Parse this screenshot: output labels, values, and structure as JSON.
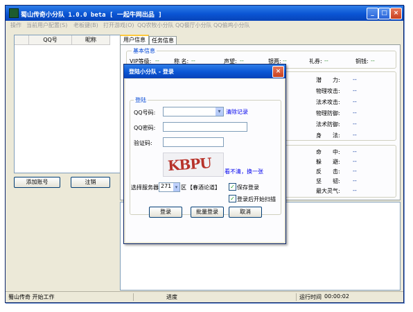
{
  "window": {
    "title": "蜀山传奇小分队 1.0.0 beta [ 一起牛网出品 ]",
    "min_glyph": "_",
    "max_glyph": "□",
    "close_glyph": "×"
  },
  "menu": [
    "操作",
    "当前用户配置(S)",
    "老板键(B)",
    "打开游戏(O)",
    "QQ农牧小分队",
    "QQ餐厅小分队",
    "QQ偷鸡小分队"
  ],
  "account_list": {
    "columns": [
      "QQ号",
      "昵称"
    ],
    "add_button": "添加账号",
    "logout_button": "注销"
  },
  "tabs": [
    {
      "label": "用户信息",
      "active": true
    },
    {
      "label": "任务信息",
      "active": false
    }
  ],
  "user_info": {
    "basic_title": "基本信息",
    "basic_fields": [
      {
        "label": "VIP等级:",
        "value": "--"
      },
      {
        "label": "称 名:",
        "value": "--"
      },
      {
        "label": "声望:",
        "value": "--"
      },
      {
        "label": "银两:",
        "value": "--"
      },
      {
        "label": "礼券:",
        "value": "--"
      },
      {
        "label": "铜钱:",
        "value": "--"
      }
    ],
    "stats_a": [
      {
        "label": "潜　　力:",
        "value": "--"
      },
      {
        "label": "物理攻击:",
        "value": "--"
      },
      {
        "label": "法术攻击:",
        "value": "--"
      },
      {
        "label": "物理防御:",
        "value": "--"
      },
      {
        "label": "法术防御:",
        "value": "--"
      },
      {
        "label": "身　　法:",
        "value": "--"
      }
    ],
    "stats_b": [
      {
        "label": "命　　中:",
        "value": "--"
      },
      {
        "label": "躲　　避:",
        "value": "--"
      },
      {
        "label": "反　　击:",
        "value": "--"
      },
      {
        "label": "坚　　韧:",
        "value": "--"
      },
      {
        "label": "最大灵气:",
        "value": "--"
      }
    ]
  },
  "status": {
    "left": "蜀山传奇 开始工作",
    "progress_label": "进度",
    "runtime_label": "运行时间",
    "runtime_value": "00:00:02"
  },
  "login_dialog": {
    "title": "登陆小分队 - 登录",
    "group_title": "登陆",
    "qq_label": "QQ号码:",
    "qq_value": "",
    "clear_link": "清除记录",
    "password_label": "QQ密码:",
    "password_value": "",
    "captcha_label": "验证码:",
    "captcha_value": "",
    "captcha_text": "KBPU",
    "refresh_link": "看不清，换一张",
    "server_label": "选择服务器",
    "server_value": "271",
    "zone_suffix": "区",
    "server_name": "【春酒论道】",
    "save_login": {
      "label": "保存登录",
      "checked": true
    },
    "auto_scan": {
      "label": "登录后开始扫描",
      "checked": true
    },
    "login_button": "登录",
    "batch_button": "批量登录",
    "cancel_button": "取消"
  }
}
